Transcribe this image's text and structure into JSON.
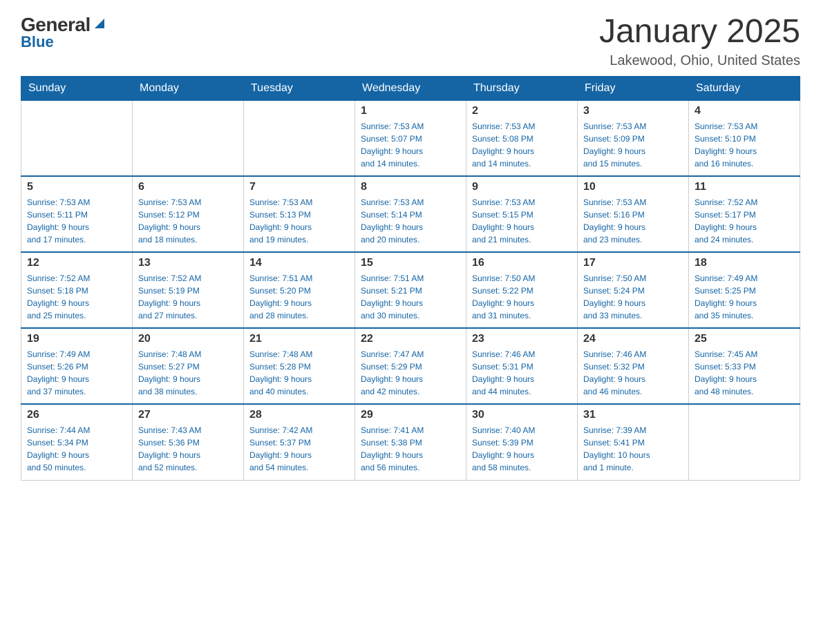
{
  "logo": {
    "general": "General",
    "blue": "Blue"
  },
  "title": "January 2025",
  "subtitle": "Lakewood, Ohio, United States",
  "weekdays": [
    "Sunday",
    "Monday",
    "Tuesday",
    "Wednesday",
    "Thursday",
    "Friday",
    "Saturday"
  ],
  "weeks": [
    [
      {
        "day": "",
        "info": ""
      },
      {
        "day": "",
        "info": ""
      },
      {
        "day": "",
        "info": ""
      },
      {
        "day": "1",
        "info": "Sunrise: 7:53 AM\nSunset: 5:07 PM\nDaylight: 9 hours\nand 14 minutes."
      },
      {
        "day": "2",
        "info": "Sunrise: 7:53 AM\nSunset: 5:08 PM\nDaylight: 9 hours\nand 14 minutes."
      },
      {
        "day": "3",
        "info": "Sunrise: 7:53 AM\nSunset: 5:09 PM\nDaylight: 9 hours\nand 15 minutes."
      },
      {
        "day": "4",
        "info": "Sunrise: 7:53 AM\nSunset: 5:10 PM\nDaylight: 9 hours\nand 16 minutes."
      }
    ],
    [
      {
        "day": "5",
        "info": "Sunrise: 7:53 AM\nSunset: 5:11 PM\nDaylight: 9 hours\nand 17 minutes."
      },
      {
        "day": "6",
        "info": "Sunrise: 7:53 AM\nSunset: 5:12 PM\nDaylight: 9 hours\nand 18 minutes."
      },
      {
        "day": "7",
        "info": "Sunrise: 7:53 AM\nSunset: 5:13 PM\nDaylight: 9 hours\nand 19 minutes."
      },
      {
        "day": "8",
        "info": "Sunrise: 7:53 AM\nSunset: 5:14 PM\nDaylight: 9 hours\nand 20 minutes."
      },
      {
        "day": "9",
        "info": "Sunrise: 7:53 AM\nSunset: 5:15 PM\nDaylight: 9 hours\nand 21 minutes."
      },
      {
        "day": "10",
        "info": "Sunrise: 7:53 AM\nSunset: 5:16 PM\nDaylight: 9 hours\nand 23 minutes."
      },
      {
        "day": "11",
        "info": "Sunrise: 7:52 AM\nSunset: 5:17 PM\nDaylight: 9 hours\nand 24 minutes."
      }
    ],
    [
      {
        "day": "12",
        "info": "Sunrise: 7:52 AM\nSunset: 5:18 PM\nDaylight: 9 hours\nand 25 minutes."
      },
      {
        "day": "13",
        "info": "Sunrise: 7:52 AM\nSunset: 5:19 PM\nDaylight: 9 hours\nand 27 minutes."
      },
      {
        "day": "14",
        "info": "Sunrise: 7:51 AM\nSunset: 5:20 PM\nDaylight: 9 hours\nand 28 minutes."
      },
      {
        "day": "15",
        "info": "Sunrise: 7:51 AM\nSunset: 5:21 PM\nDaylight: 9 hours\nand 30 minutes."
      },
      {
        "day": "16",
        "info": "Sunrise: 7:50 AM\nSunset: 5:22 PM\nDaylight: 9 hours\nand 31 minutes."
      },
      {
        "day": "17",
        "info": "Sunrise: 7:50 AM\nSunset: 5:24 PM\nDaylight: 9 hours\nand 33 minutes."
      },
      {
        "day": "18",
        "info": "Sunrise: 7:49 AM\nSunset: 5:25 PM\nDaylight: 9 hours\nand 35 minutes."
      }
    ],
    [
      {
        "day": "19",
        "info": "Sunrise: 7:49 AM\nSunset: 5:26 PM\nDaylight: 9 hours\nand 37 minutes."
      },
      {
        "day": "20",
        "info": "Sunrise: 7:48 AM\nSunset: 5:27 PM\nDaylight: 9 hours\nand 38 minutes."
      },
      {
        "day": "21",
        "info": "Sunrise: 7:48 AM\nSunset: 5:28 PM\nDaylight: 9 hours\nand 40 minutes."
      },
      {
        "day": "22",
        "info": "Sunrise: 7:47 AM\nSunset: 5:29 PM\nDaylight: 9 hours\nand 42 minutes."
      },
      {
        "day": "23",
        "info": "Sunrise: 7:46 AM\nSunset: 5:31 PM\nDaylight: 9 hours\nand 44 minutes."
      },
      {
        "day": "24",
        "info": "Sunrise: 7:46 AM\nSunset: 5:32 PM\nDaylight: 9 hours\nand 46 minutes."
      },
      {
        "day": "25",
        "info": "Sunrise: 7:45 AM\nSunset: 5:33 PM\nDaylight: 9 hours\nand 48 minutes."
      }
    ],
    [
      {
        "day": "26",
        "info": "Sunrise: 7:44 AM\nSunset: 5:34 PM\nDaylight: 9 hours\nand 50 minutes."
      },
      {
        "day": "27",
        "info": "Sunrise: 7:43 AM\nSunset: 5:36 PM\nDaylight: 9 hours\nand 52 minutes."
      },
      {
        "day": "28",
        "info": "Sunrise: 7:42 AM\nSunset: 5:37 PM\nDaylight: 9 hours\nand 54 minutes."
      },
      {
        "day": "29",
        "info": "Sunrise: 7:41 AM\nSunset: 5:38 PM\nDaylight: 9 hours\nand 56 minutes."
      },
      {
        "day": "30",
        "info": "Sunrise: 7:40 AM\nSunset: 5:39 PM\nDaylight: 9 hours\nand 58 minutes."
      },
      {
        "day": "31",
        "info": "Sunrise: 7:39 AM\nSunset: 5:41 PM\nDaylight: 10 hours\nand 1 minute."
      },
      {
        "day": "",
        "info": ""
      }
    ]
  ]
}
